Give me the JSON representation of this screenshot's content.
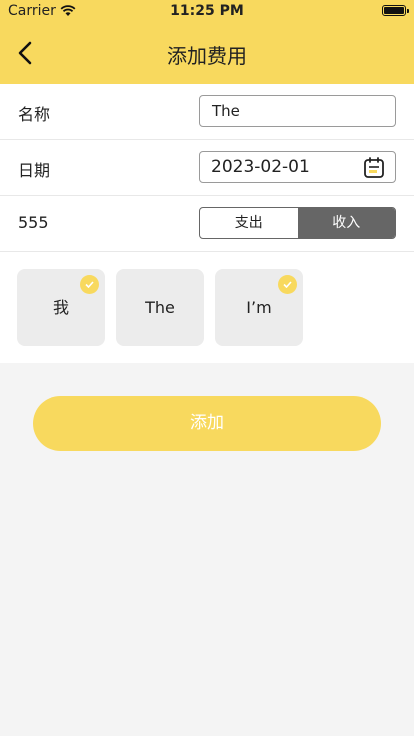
{
  "status": {
    "carrier": "Carrier",
    "time": "11:25 PM"
  },
  "header": {
    "title": "添加费用",
    "back_icon": "chevron-left-icon"
  },
  "form": {
    "name_label": "名称",
    "name_value": "The",
    "date_label": "日期",
    "date_value": "2023-02-01",
    "amount_label": "555",
    "type_options": [
      "支出",
      "收入"
    ],
    "type_selected": "收入"
  },
  "members": [
    {
      "label": "我",
      "checked": true
    },
    {
      "label": "The",
      "checked": false
    },
    {
      "label": "I’m",
      "checked": true
    }
  ],
  "add_button": "添加",
  "colors": {
    "accent": "#f8d95e",
    "segment_selected": "#666666",
    "background": "#f4f4f4"
  }
}
